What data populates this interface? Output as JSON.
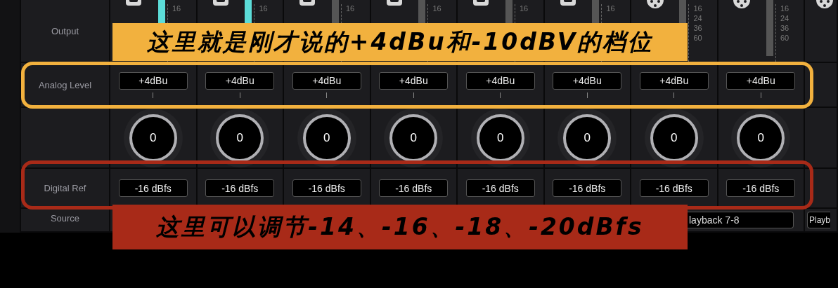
{
  "row_labels": {
    "output": "Output",
    "analog_level": "Analog Level",
    "digital_ref": "Digital Ref",
    "source": "Source"
  },
  "channels": [
    {
      "connector": {
        "kind": "jack"
      },
      "meter_active": true,
      "meter_ticks": [
        "16"
      ],
      "analog_level": "+4dBu",
      "knob": "0",
      "digital_ref": "-16 dBfs"
    },
    {
      "connector": {
        "kind": "jack"
      },
      "meter_active": true,
      "meter_ticks": [
        "16"
      ],
      "analog_level": "+4dBu",
      "knob": "0",
      "digital_ref": "-16 dBfs"
    },
    {
      "connector": {
        "kind": "jack"
      },
      "meter_active": false,
      "meter_ticks": [
        "16"
      ],
      "analog_level": "+4dBu",
      "knob": "0",
      "digital_ref": "-16 dBfs"
    },
    {
      "connector": {
        "kind": "jack"
      },
      "meter_active": false,
      "meter_ticks": [
        "16"
      ],
      "analog_level": "+4dBu",
      "knob": "0",
      "digital_ref": "-16 dBfs"
    },
    {
      "connector": {
        "kind": "jack"
      },
      "meter_active": false,
      "meter_ticks": [
        "16"
      ],
      "analog_level": "+4dBu",
      "knob": "0",
      "digital_ref": "-16 dBfs"
    },
    {
      "connector": {
        "kind": "jack"
      },
      "meter_active": false,
      "meter_ticks": [
        "16"
      ],
      "analog_level": "+4dBu",
      "knob": "0",
      "digital_ref": "-16 dBfs"
    },
    {
      "connector": {
        "kind": "xlr"
      },
      "meter_active": false,
      "meter_ticks": [
        "16",
        "24",
        "36",
        "60"
      ],
      "analog_level": "+4dBu",
      "knob": "0",
      "digital_ref": "-16 dBfs",
      "source": "layback 7-8"
    },
    {
      "connector": {
        "kind": "xlr"
      },
      "meter_active": false,
      "meter_ticks": [
        "16",
        "24",
        "36",
        "60"
      ],
      "analog_level": "+4dBu",
      "knob": "0",
      "digital_ref": "-16 dBfs"
    }
  ],
  "partial_channel": {
    "connector": {
      "kind": "xlr"
    },
    "source": "Playb"
  },
  "annotations": [
    {
      "text": "这里就是刚才说的+4dBu和-10dBV的档位",
      "color": "#f2b13e"
    },
    {
      "text": "这里可以调节-14、-16、-18、-20dBfs",
      "color": "#a82a18"
    }
  ]
}
